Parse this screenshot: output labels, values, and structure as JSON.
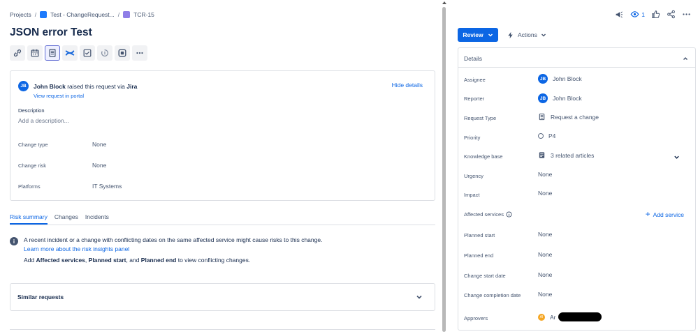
{
  "breadcrumb": {
    "root": "Projects",
    "project": "Test - ChangeRequest...",
    "issue": "TCR-15"
  },
  "page_title": "JSON error Test",
  "toolbar": {
    "icons": [
      "link-icon",
      "calendar-icon",
      "document-icon",
      "confluence-icon",
      "checkbox-icon",
      "loading-icon",
      "app-icon",
      "more-icon"
    ]
  },
  "request": {
    "avatar_initials": "JB",
    "reporter_name": "John Block",
    "raised_text": "raised this request via",
    "channel": "Jira",
    "view_portal": "View request in portal",
    "hide_details": "Hide details",
    "description_label": "Description",
    "description_placeholder": "Add a description...",
    "fields": [
      {
        "label": "Change type",
        "value": "None"
      },
      {
        "label": "Change risk",
        "value": "None"
      },
      {
        "label": "Platforms",
        "value": "IT Systems"
      }
    ]
  },
  "tabs": [
    "Risk summary",
    "Changes",
    "Incidents"
  ],
  "risk": {
    "message": "A recent incident or a change with conflicting dates on the same affected service might cause risks to this change.",
    "learn_more": "Learn more about the risk insights panel",
    "hint_prefix": "Add",
    "hint_field1": "Affected services",
    "hint_sep1": ",",
    "hint_field2": "Planned start",
    "hint_sep2": ", and",
    "hint_field3": "Planned end",
    "hint_suffix": "to view conflicting changes."
  },
  "similar_requests": "Similar requests",
  "top_actions": {
    "watch_count": "1"
  },
  "review_button": "Review",
  "actions_button": "Actions",
  "details": {
    "title": "Details",
    "fields": {
      "assignee": {
        "label": "Assignee",
        "value": "John Block",
        "initials": "JB"
      },
      "reporter": {
        "label": "Reporter",
        "value": "John Block",
        "initials": "JB"
      },
      "request_type": {
        "label": "Request Type",
        "value": "Request a change"
      },
      "priority": {
        "label": "Priority",
        "value": "P4"
      },
      "knowledge_base": {
        "label": "Knowledge base",
        "value": "3 related articles"
      },
      "urgency": {
        "label": "Urgency",
        "value": "None"
      },
      "impact": {
        "label": "Impact",
        "value": "None"
      },
      "affected_services": {
        "label": "Affected services",
        "action": "Add service"
      },
      "planned_start": {
        "label": "Planned start",
        "value": "None"
      },
      "planned_end": {
        "label": "Planned end",
        "value": "None"
      },
      "change_start_date": {
        "label": "Change start date",
        "value": "None"
      },
      "change_completion_date": {
        "label": "Change completion date",
        "value": "None"
      },
      "approvers": {
        "label": "Approvers",
        "value": "Ar",
        "initials": "AI"
      }
    }
  },
  "colors": {
    "accent": "#0c66e4",
    "text": "#172b4d",
    "subtle": "#44546f",
    "border": "#dcdfe4"
  }
}
